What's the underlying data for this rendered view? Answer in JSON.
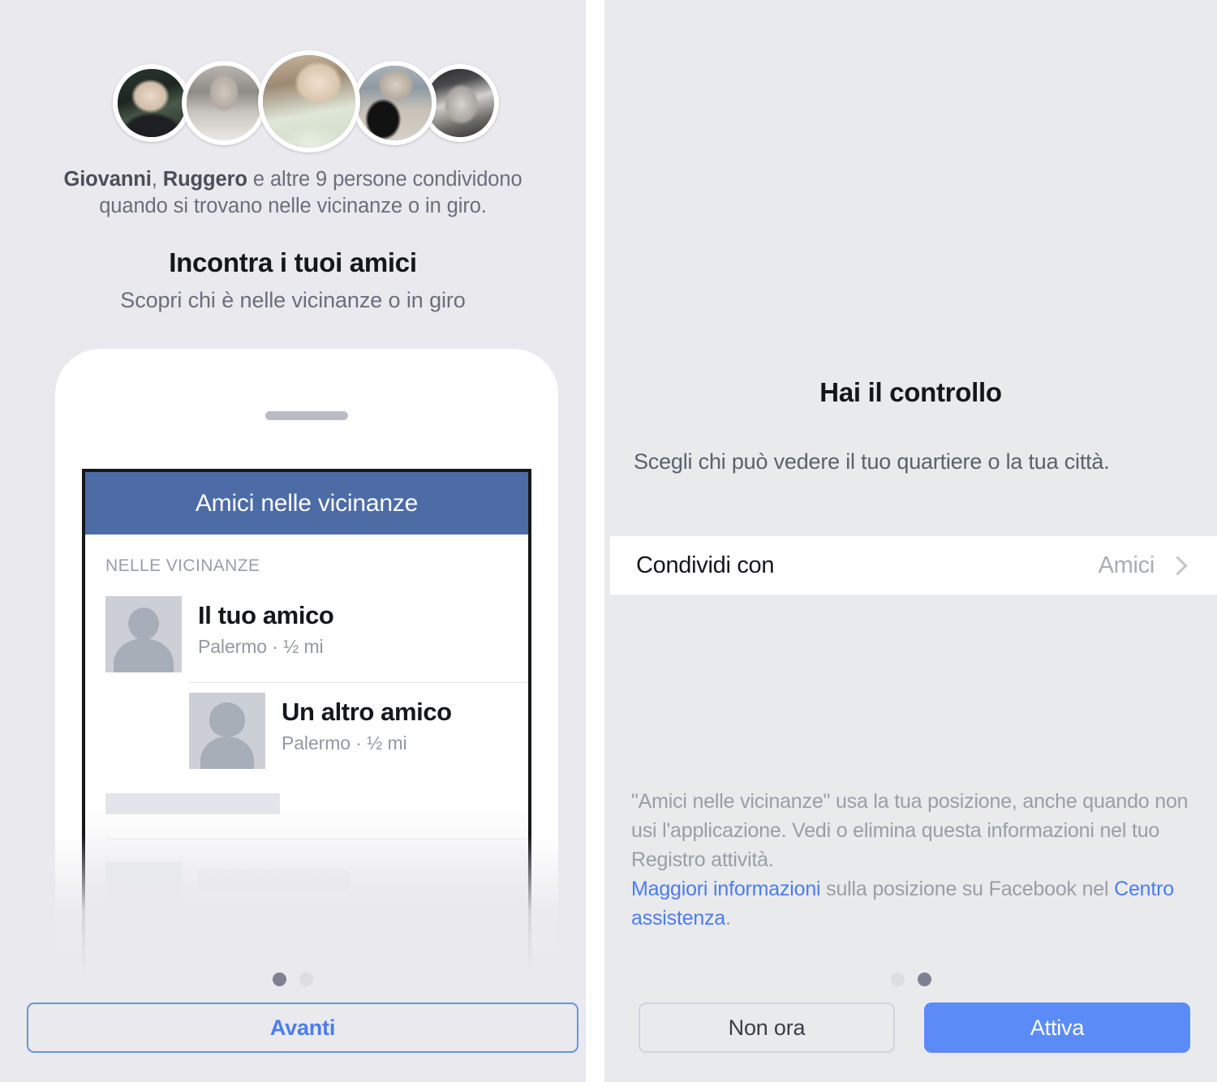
{
  "colors": {
    "page_bg_left": "#e9e9ee",
    "page_bg_right": "#e9eaec",
    "fb_blue_bar": "#4d6ba5",
    "link_blue": "#4a7ded",
    "primary_button_blue": "#5b8bf7",
    "outline_blue": "#6a93dd",
    "muted_text": "#6b6e79",
    "dot_active": "#7d8191",
    "dot_inactive": "#dcdde1"
  },
  "left_screen": {
    "avatars": [
      {
        "name": "friend-avatar-1"
      },
      {
        "name": "friend-avatar-2"
      },
      {
        "name": "friend-avatar-3"
      },
      {
        "name": "friend-avatar-4"
      },
      {
        "name": "friend-avatar-5"
      }
    ],
    "caption": {
      "name_1": "Giovanni",
      "separator_1": ", ",
      "name_2": "Ruggero",
      "rest": " e altre 9 persone condividono quando si trovano nelle vicinanze o in giro."
    },
    "title": "Incontra i tuoi amici",
    "subtitle": "Scopri chi è nelle vicinanze o in giro",
    "phone_preview": {
      "app_bar_title": "Amici nelle vicinanze",
      "section_label": "NELLE VICINANZE",
      "rows": [
        {
          "name": "Il tuo amico",
          "meta": "Palermo · ½ mi",
          "avatar": "male-placeholder-avatar"
        },
        {
          "name": "Un altro amico",
          "meta": "Palermo · ½ mi",
          "avatar": "female-placeholder-avatar"
        }
      ]
    },
    "pagination": {
      "total": 2,
      "active": 1
    },
    "next_button": "Avanti"
  },
  "right_screen": {
    "title": "Hai il controllo",
    "subtitle": "Scegli chi può vedere il tuo quartiere o la tua città.",
    "share_row": {
      "label": "Condividi con",
      "value": "Amici",
      "chevron": "chevron-right-icon"
    },
    "legal": {
      "paragraph": "\"Amici nelle vicinanze\" usa la tua posizione, anche quando non usi l'applicazione. Vedi o elimina questa informazioni nel tuo Registro attività.",
      "link_1": "Maggiori informazioni",
      "mid_text": " sulla posizione su Facebook nel ",
      "link_2": "Centro assistenza",
      "tail": "."
    },
    "pagination": {
      "total": 2,
      "active": 2
    },
    "secondary_button": "Non ora",
    "primary_button": "Attiva"
  }
}
